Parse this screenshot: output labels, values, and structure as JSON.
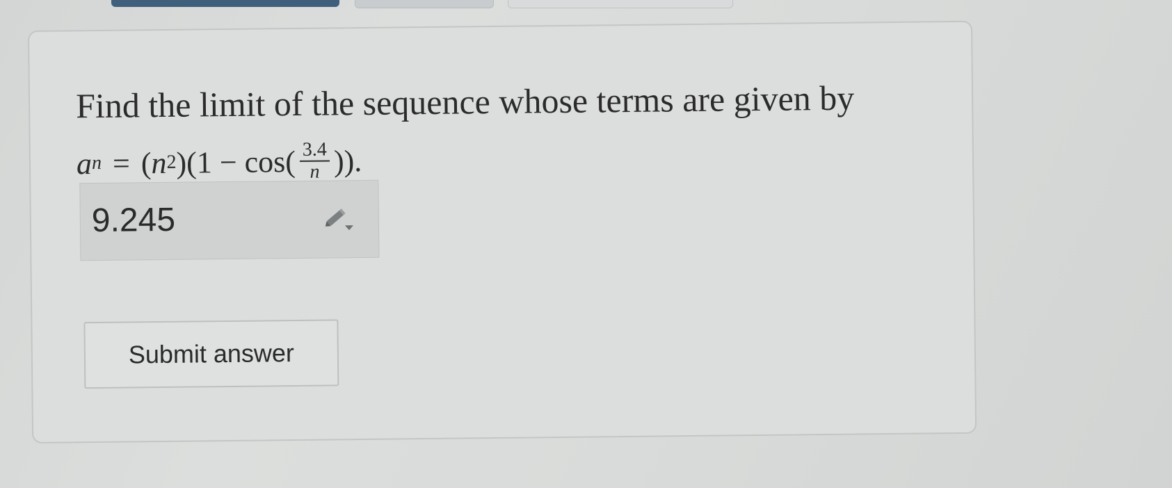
{
  "question": {
    "text": "Find the limit of the sequence whose terms are given by",
    "formula": {
      "lhs_var": "a",
      "lhs_sub": "n",
      "equals": "=",
      "open_paren": "(",
      "base": "n",
      "exponent": "2",
      "close_paren": ")",
      "cos_prefix": "(1 − cos(",
      "frac_num": "3.4",
      "frac_den": "n",
      "suffix": "))."
    }
  },
  "answer": {
    "value": "9.245",
    "edit_icon": "pencil-dropdown-icon"
  },
  "submit": {
    "label": "Submit answer"
  },
  "colors": {
    "background": "#d7d9d8",
    "card": "#dcdedd",
    "answer_box": "#cfd2d1",
    "text": "#2b2b2b",
    "active_tab": "#3f5f7d"
  }
}
